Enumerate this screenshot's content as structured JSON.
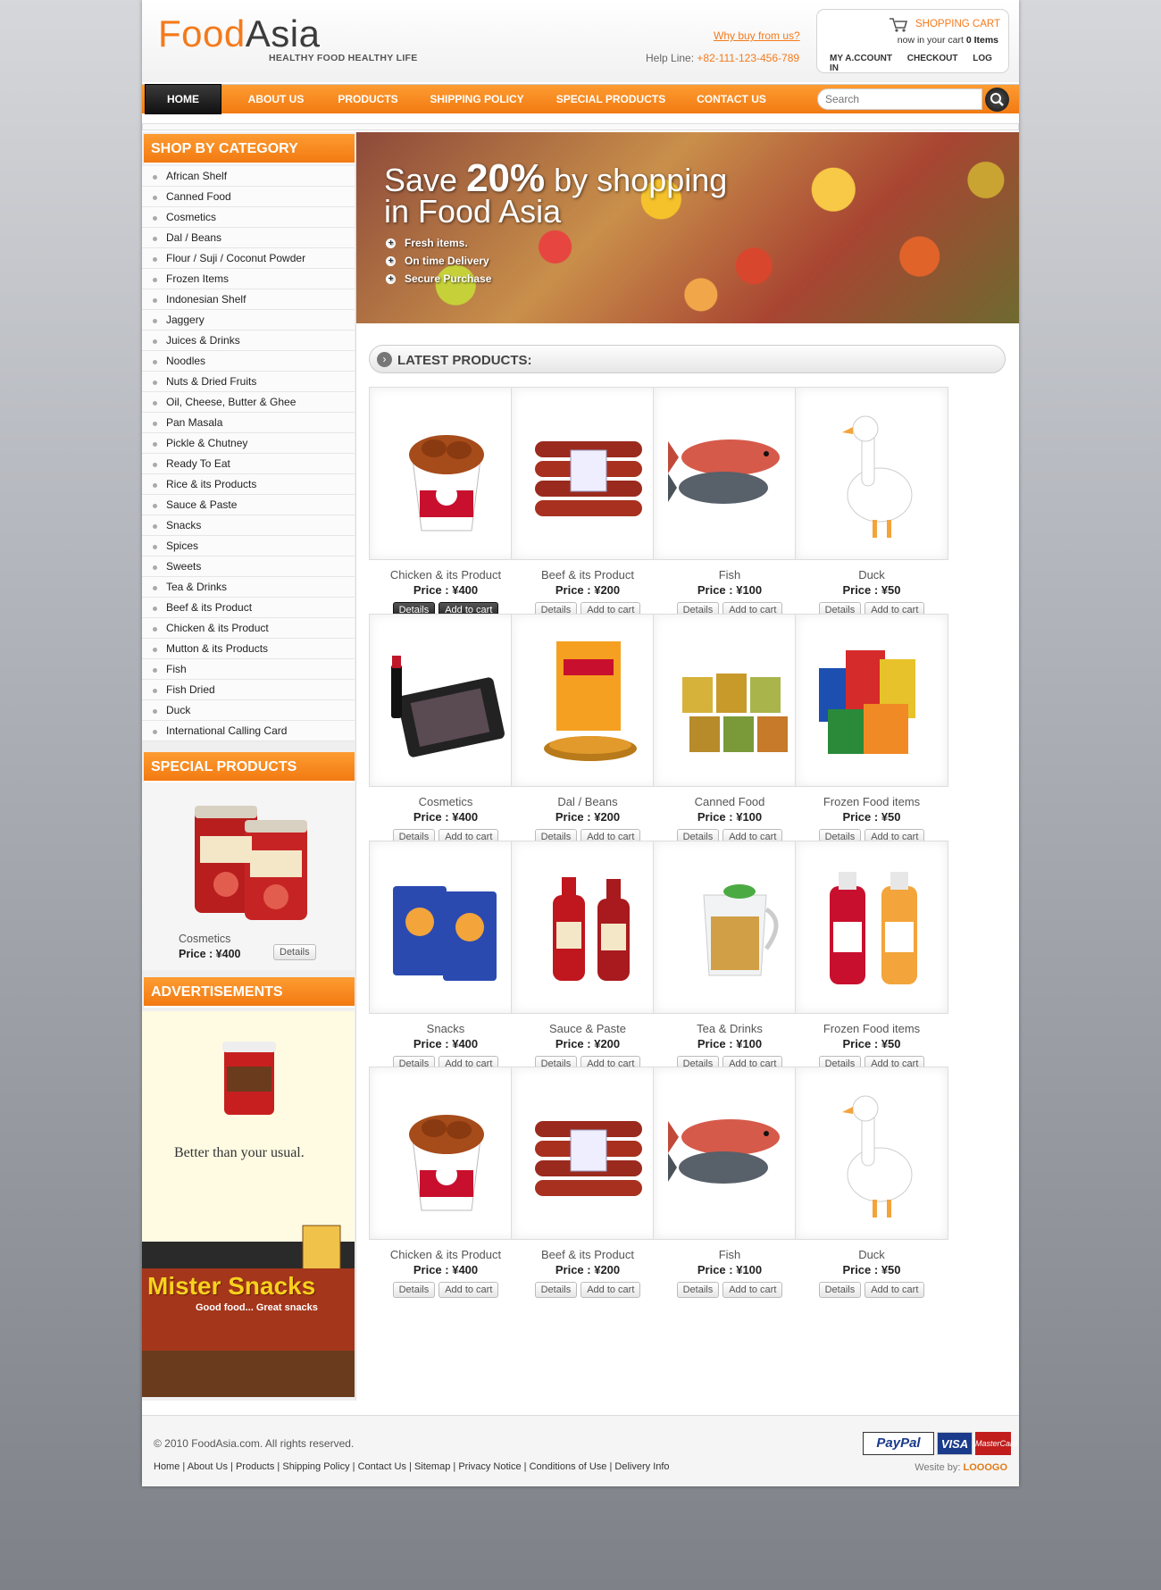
{
  "header": {
    "logo_part1": "Food",
    "logo_part2": "Asia",
    "tagline": "HEALTHY FOOD HEALTHY LIFE",
    "why_buy": "Why buy from us?",
    "helpline_label": "Help Line:",
    "helpline_number": "+82-111-123-456-789",
    "cart_title": "SHOPPING CART",
    "cart_status_prefix": "now in your cart",
    "cart_count": "0 Items",
    "account": "MY A.CCOUNT",
    "checkout": "CHECKOUT",
    "login": "LOG IN"
  },
  "nav": {
    "items": [
      "HOME",
      "ABOUT US",
      "PRODUCTS",
      "SHIPPING POLICY",
      "SPECIAL PRODUCTS",
      "CONTACT US"
    ],
    "search_placeholder": "Search"
  },
  "sidebar": {
    "category_title": "SHOP BY CATEGORY",
    "categories": [
      "African Shelf",
      "Canned Food",
      "Cosmetics",
      "Dal / Beans",
      "Flour / Suji / Coconut Powder",
      "Frozen Items",
      "Indonesian Shelf",
      "Jaggery",
      "Juices & Drinks",
      "Noodles",
      "Nuts & Dried Fruits",
      "Oil, Cheese, Butter & Ghee",
      "Pan Masala",
      "Pickle & Chutney",
      "Ready To Eat",
      "Rice & its Products",
      "Sauce & Paste",
      "Snacks",
      "Spices",
      "Sweets",
      "Tea & Drinks",
      "Beef & its Product",
      "Chicken & its Product",
      "Mutton & its Products",
      "Fish",
      "Fish Dried",
      "Duck",
      "International Calling Card"
    ],
    "special_title": "SPECIAL PRODUCTS",
    "special_name": "Cosmetics",
    "special_price": "Price : ¥400",
    "special_details": "Details",
    "ads_title": "ADVERTISEMENTS",
    "ad1_text": "Better than your usual.",
    "ad2_text": "Mister Snacks",
    "ad2_sub": "Good food... Great snacks"
  },
  "banner": {
    "line1_a": "Save ",
    "line1_b": "20%",
    "line1_c": " by shopping",
    "line2": "in Food Asia",
    "bullets": [
      "Fresh items.",
      "On time Delivery",
      "Secure Purchase"
    ]
  },
  "latest": {
    "title": "LATEST PRODUCTS:",
    "details_label": "Details",
    "cart_label": "Add to cart",
    "products": [
      {
        "name": "Chicken & its Product",
        "price": "Price : ¥400",
        "icon": "chicken-bucket"
      },
      {
        "name": "Beef & its Product",
        "price": "Price : ¥200",
        "icon": "sausages"
      },
      {
        "name": "Fish",
        "price": "Price : ¥100",
        "icon": "fish"
      },
      {
        "name": "Duck",
        "price": "Price : ¥50",
        "icon": "duck"
      },
      {
        "name": "Cosmetics",
        "price": "Price : ¥400",
        "icon": "makeup"
      },
      {
        "name": "Dal / Beans",
        "price": "Price : ¥200",
        "icon": "dal"
      },
      {
        "name": "Canned Food",
        "price": "Price : ¥100",
        "icon": "cans"
      },
      {
        "name": "Frozen Food items",
        "price": "Price : ¥50",
        "icon": "packets"
      },
      {
        "name": "Snacks",
        "price": "Price : ¥400",
        "icon": "chips"
      },
      {
        "name": "Sauce & Paste",
        "price": "Price : ¥200",
        "icon": "sauce"
      },
      {
        "name": "Tea & Drinks",
        "price": "Price : ¥100",
        "icon": "tea"
      },
      {
        "name": "Frozen Food items",
        "price": "Price : ¥50",
        "icon": "juice"
      },
      {
        "name": "Chicken & its Product",
        "price": "Price : ¥400",
        "icon": "chicken-bucket"
      },
      {
        "name": "Beef & its Product",
        "price": "Price : ¥200",
        "icon": "sausages"
      },
      {
        "name": "Fish",
        "price": "Price : ¥100",
        "icon": "fish"
      },
      {
        "name": "Duck",
        "price": "Price : ¥50",
        "icon": "duck"
      }
    ]
  },
  "footer": {
    "copyright": "© 2010 FoodAsia.com. All rights reserved.",
    "links": [
      "Home",
      "About Us",
      "Products",
      "Shipping Policy",
      "Contact Us",
      "Sitemap",
      "Privacy Notice",
      "Conditions of Use",
      "Delivery Info"
    ],
    "paypal": "PayPal",
    "visa": "VISA",
    "mastercard": "MasterCard",
    "website_by": "Wesite by:",
    "website_brand": "LOOOGO"
  },
  "colors": {
    "accent": "#f47a1c",
    "dark": "#222222"
  }
}
